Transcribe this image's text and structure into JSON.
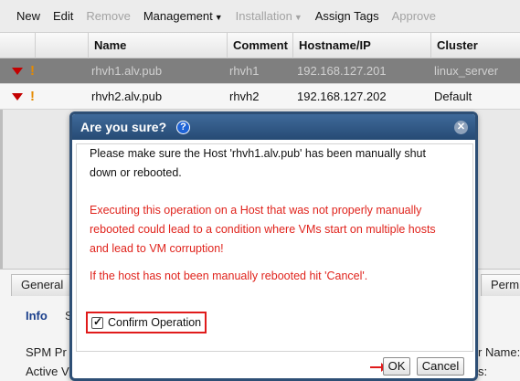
{
  "toolbar": {
    "items": [
      {
        "label": "New",
        "enabled": true
      },
      {
        "label": "Edit",
        "enabled": true
      },
      {
        "label": "Remove",
        "enabled": false
      },
      {
        "label": "Management",
        "enabled": true,
        "dropdown": true
      },
      {
        "label": "Installation",
        "enabled": false,
        "dropdown": true
      },
      {
        "label": "Assign Tags",
        "enabled": true
      },
      {
        "label": "Approve",
        "enabled": false
      }
    ]
  },
  "grid": {
    "columns": [
      "Name",
      "Comment",
      "Hostname/IP",
      "Cluster"
    ],
    "rows": [
      {
        "name": "rhvh1.alv.pub",
        "comment": "rhvh1",
        "hostname": "192.168.127.201",
        "cluster": "linux_server",
        "status_icon": "down-arrow-icon",
        "alert_icon": "exclamation-icon",
        "selected": true
      },
      {
        "name": "rhvh2.alv.pub",
        "comment": "rhvh2",
        "hostname": "192.168.127.202",
        "cluster": "Default",
        "status_icon": "down-arrow-icon",
        "alert_icon": "exclamation-icon",
        "selected": false
      }
    ]
  },
  "details": {
    "tabs": [
      "General",
      "Perm"
    ],
    "subtabs": [
      "Info",
      "S"
    ],
    "lines": [
      "SPM Pr",
      "Active V",
      "r Name:",
      "s:"
    ]
  },
  "dialog": {
    "title": "Are you sure?",
    "help_icon": "question-mark-icon",
    "close_icon": "close-icon",
    "message_line1": "Please make sure the Host 'rhvh1.alv.pub' has been manually shut",
    "message_line2": "down or rebooted.",
    "warning_line1": "Executing this operation on a Host that was not properly manually",
    "warning_line2": "rebooted could lead to a condition where VMs start on multiple hosts",
    "warning_line3": "and lead to VM corruption!",
    "cancel_hint": "If the host has not been manually rebooted hit 'Cancel'.",
    "confirm_label": "Confirm Operation",
    "confirm_checked": true,
    "ok_label": "OK",
    "cancel_label": "Cancel"
  },
  "colors": {
    "dialog_title_bg": "#2e4f75",
    "warning_text": "#e0231c",
    "highlight_box": "#e01b1b",
    "selected_row": "#7f7f7f",
    "status_down": "#c40000",
    "alert": "#e58a00"
  }
}
